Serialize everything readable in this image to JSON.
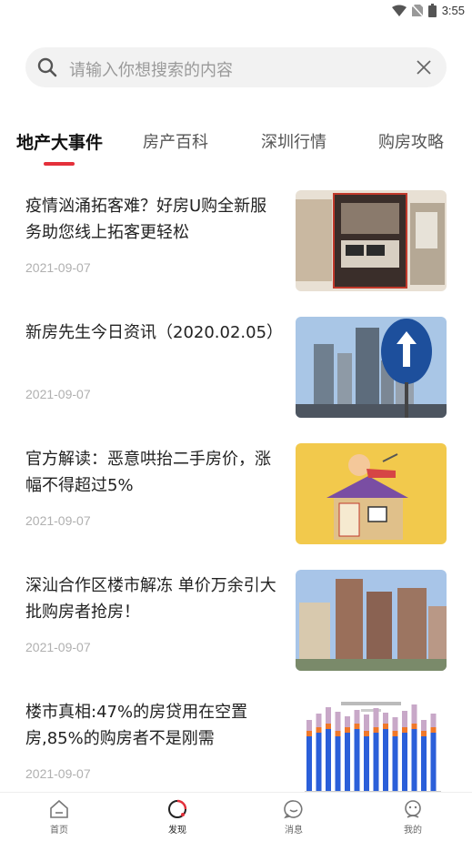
{
  "status_bar": {
    "time": "3:55"
  },
  "search": {
    "placeholder": "请输入你想搜索的内容"
  },
  "tabs": [
    {
      "label": "地产大事件",
      "active": true
    },
    {
      "label": "房产百科",
      "active": false
    },
    {
      "label": "深圳行情",
      "active": false
    },
    {
      "label": "购房攻略",
      "active": false
    }
  ],
  "news": [
    {
      "title": "疫情汹涌拓客难？好房U购全新服务助您线上拓客更轻松",
      "date": "2021-09-07"
    },
    {
      "title": "新房先生今日资讯（2020.02.05）",
      "date": "2021-09-07"
    },
    {
      "title": "官方解读：恶意哄抬二手房价，涨幅不得超过5%",
      "date": "2021-09-07"
    },
    {
      "title": "深汕合作区楼市解冻 单价万余引大批购房者抢房！",
      "date": "2021-09-07"
    },
    {
      "title": "楼市真相:47%的房贷用在空置房,85%的购房者不是刚需",
      "date": "2021-09-07"
    }
  ],
  "bottom_nav": [
    {
      "label": "首页",
      "icon": "home-icon"
    },
    {
      "label": "发现",
      "icon": "discover-icon",
      "active": true
    },
    {
      "label": "消息",
      "icon": "message-icon"
    },
    {
      "label": "我的",
      "icon": "profile-icon"
    }
  ],
  "colors": {
    "accent": "#e4303b"
  }
}
